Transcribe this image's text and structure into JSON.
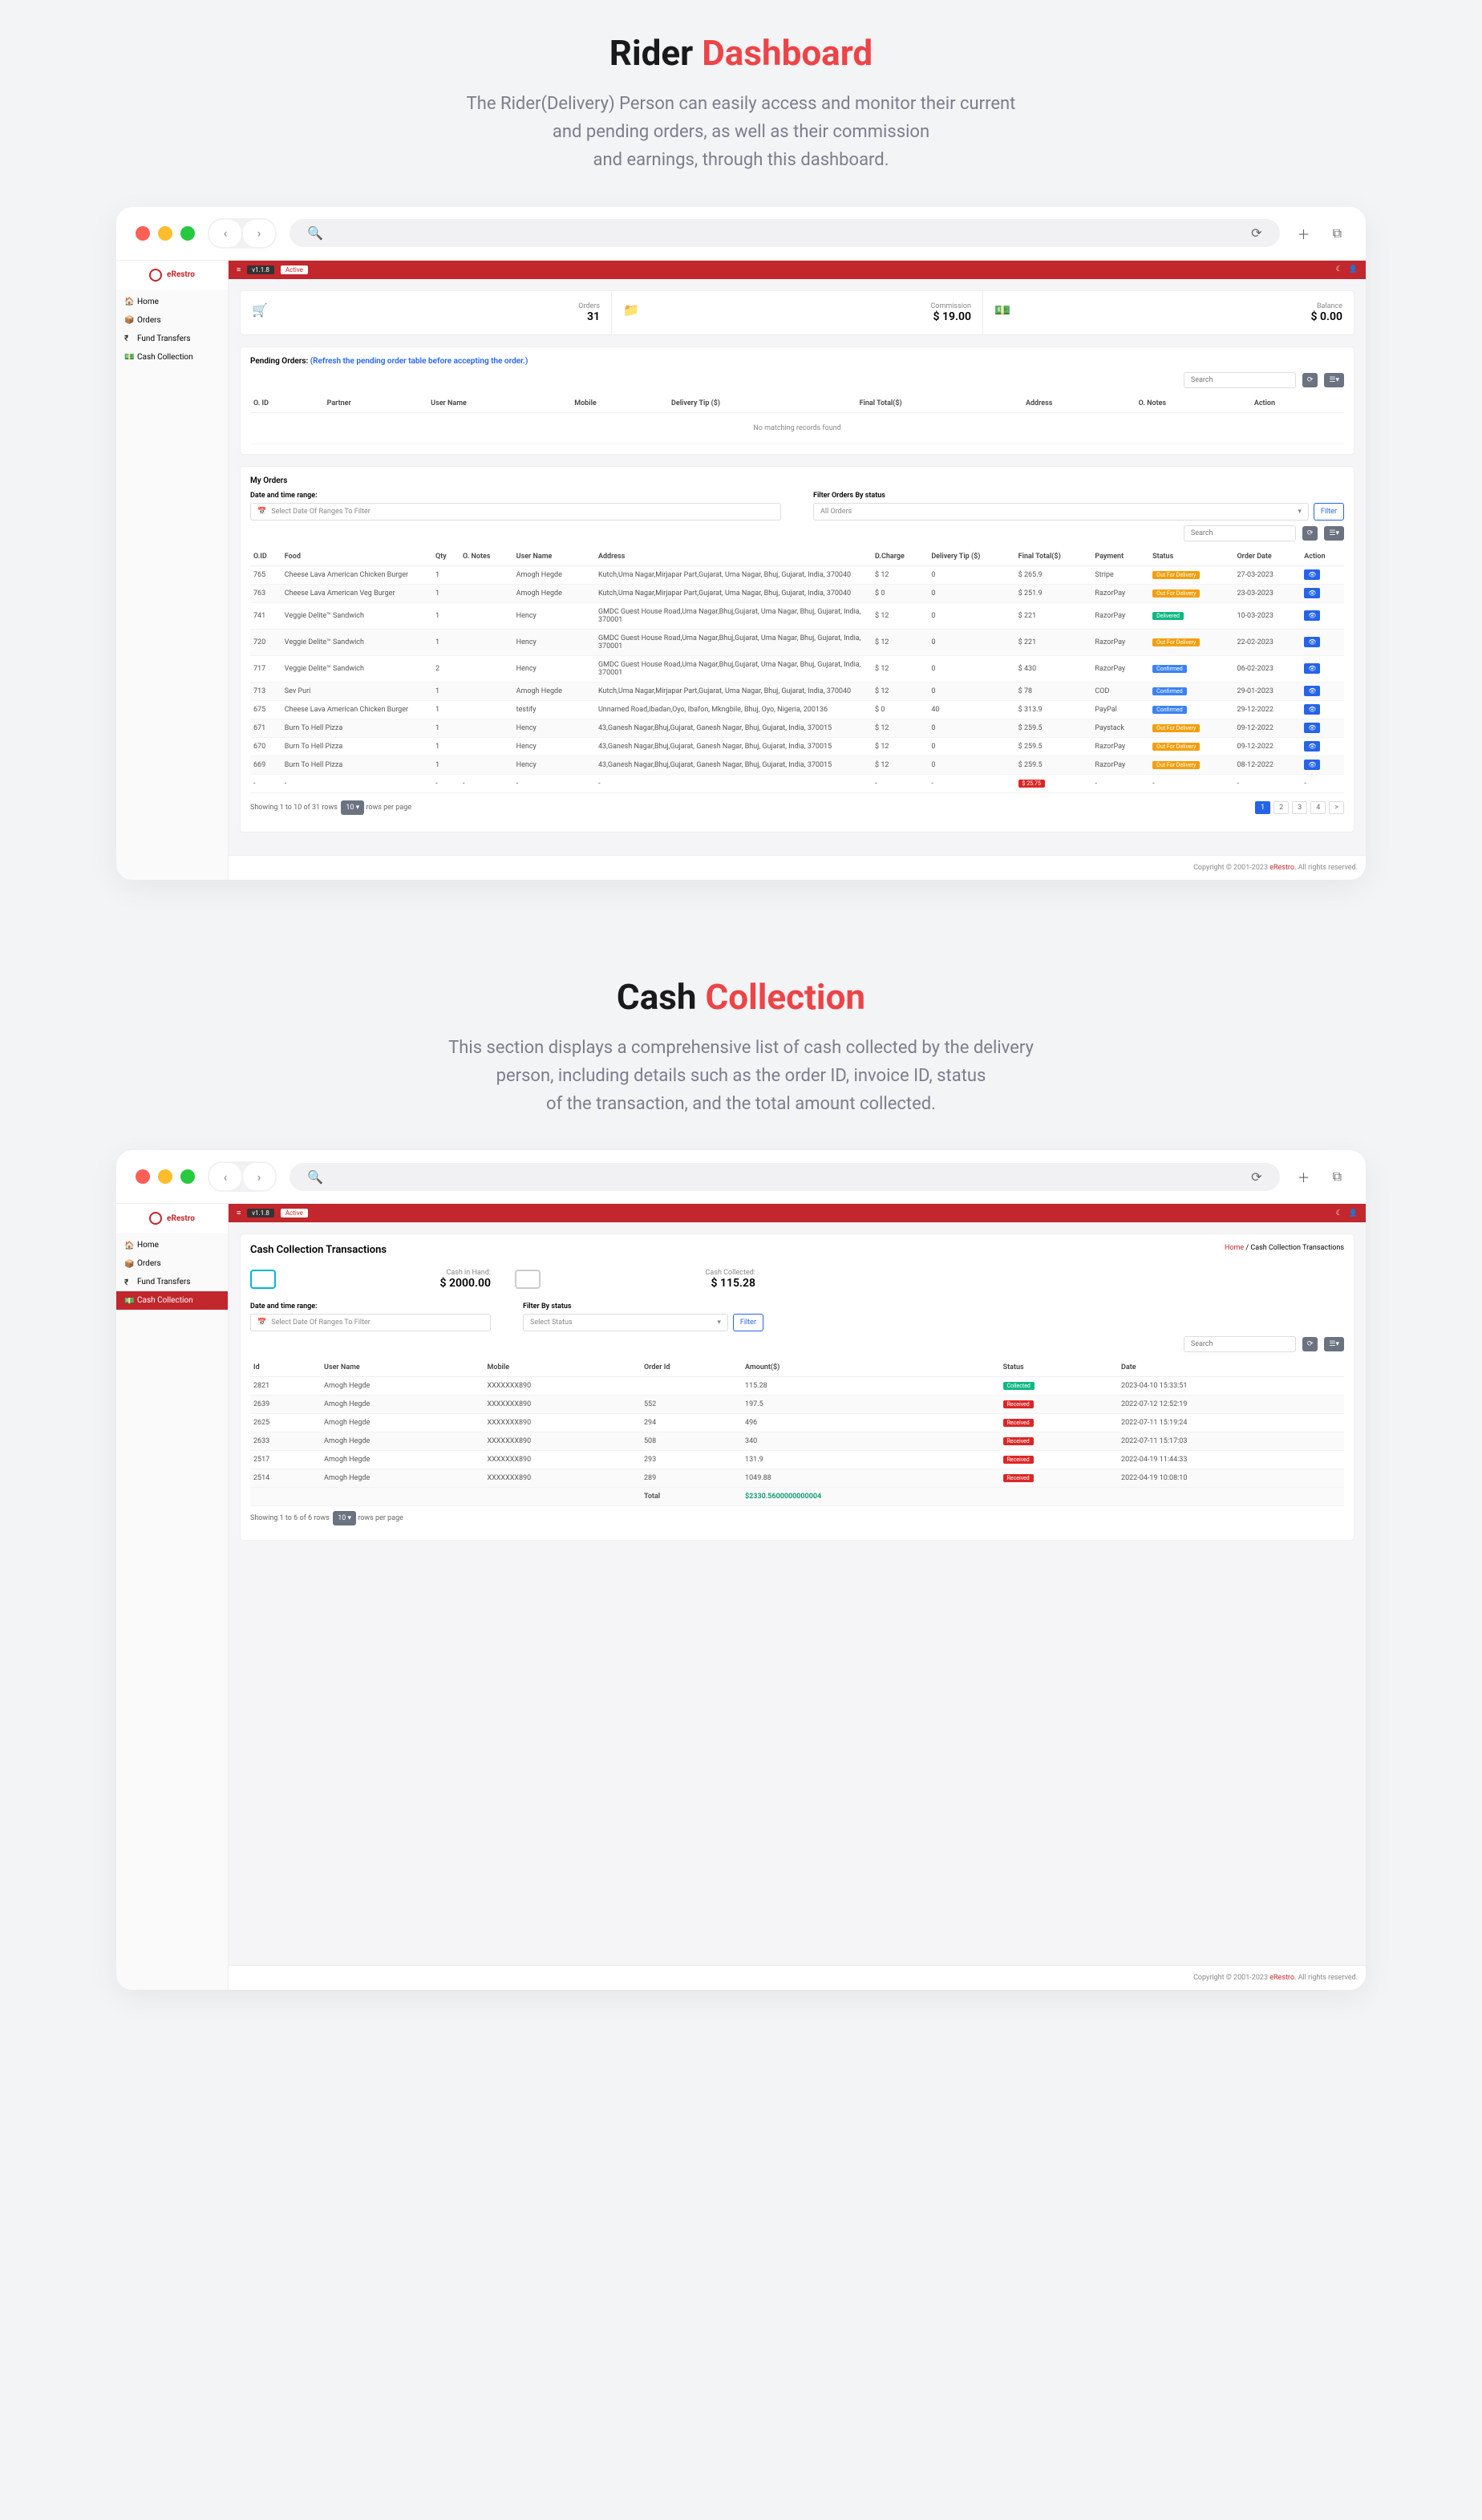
{
  "hero1": {
    "title1": "Rider",
    "title2": "Dashboard",
    "desc": "The Rider(Delivery) Person can easily access and monitor their current\nand pending orders, as well as their commission\nand earnings, through this dashboard."
  },
  "hero2": {
    "title1": "Cash",
    "title2": "Collection",
    "desc": "This section displays a comprehensive list of cash collected by the delivery\nperson, including details such as the order ID, invoice ID, status\nof the transaction, and the total amount collected."
  },
  "logo": "eRestro",
  "topbarVersion": "v1.1.8",
  "topbarStatus": "Active",
  "sidebar": [
    {
      "icon": "🏠",
      "label": "Home",
      "active": false
    },
    {
      "icon": "📦",
      "label": "Orders",
      "active": false
    },
    {
      "icon": "₹",
      "label": "Fund Transfers",
      "active": false
    },
    {
      "icon": "💵",
      "label": "Cash Collection",
      "active": false
    }
  ],
  "stats": [
    {
      "icon": "🛒",
      "color": "#f59e0b",
      "label": "Orders",
      "value": "31"
    },
    {
      "icon": "📁",
      "color": "#2563eb",
      "label": "Commission",
      "value": "$ 19.00"
    },
    {
      "icon": "💵",
      "color": "#10b981",
      "label": "Balance",
      "value": "$ 0.00"
    }
  ],
  "pending": {
    "title": "Pending Orders:",
    "link": "(Refresh the pending order table before accepting the order.)",
    "search": "Search",
    "headers": [
      "O. ID",
      "Partner",
      "User Name",
      "Mobile",
      "Delivery Tip ($)",
      "Final Total($)",
      "Address",
      "O. Notes",
      "Action"
    ],
    "empty": "No matching records found"
  },
  "myOrders": {
    "title": "My Orders",
    "filterDateLabel": "Date and time range:",
    "filterDatePh": "Select Date Of Ranges To Filter",
    "filterStatusLabel": "Filter Orders By status",
    "filterStatusPh": "All Orders",
    "filterBtn": "Filter",
    "search": "Search",
    "headers": [
      "O.ID",
      "Food",
      "Qty",
      "O. Notes",
      "User Name",
      "Address",
      "D.Charge",
      "Delivery Tip ($)",
      "Final Total($)",
      "Payment",
      "Status",
      "Order Date",
      "Action"
    ],
    "rows": [
      {
        "id": "765",
        "food": "Cheese Lava American Chicken Burger",
        "qty": "1",
        "notes": "",
        "user": "Amogh Hegde",
        "addr": "Kutch,Uma Nagar,Mirjapar Part,Gujarat, Uma Nagar, Bhuj, Gujarat, India, 370040",
        "dc": "$ 12",
        "tip": "0",
        "total": "$ 265.9",
        "pay": "Stripe",
        "status": "Out For Delivery",
        "sc": "s-out",
        "date": "27-03-2023"
      },
      {
        "id": "763",
        "food": "Cheese Lava American Veg Burger",
        "qty": "1",
        "notes": "",
        "user": "Amogh Hegde",
        "addr": "Kutch,Uma Nagar,Mirjapar Part,Gujarat, Uma Nagar, Bhuj, Gujarat, India, 370040",
        "dc": "$ 0",
        "tip": "0",
        "total": "$ 251.9",
        "pay": "RazorPay",
        "status": "Out For Delivery",
        "sc": "s-out",
        "date": "23-03-2023"
      },
      {
        "id": "741",
        "food": "Veggie Delite™ Sandwich",
        "qty": "1",
        "notes": "",
        "user": "Hency",
        "addr": "GMDC Guest House Road,Uma Nagar,Bhuj,Gujarat, Uma Nagar, Bhuj, Gujarat, India, 370001",
        "dc": "$ 12",
        "tip": "0",
        "total": "$ 221",
        "pay": "RazorPay",
        "status": "Delivered",
        "sc": "s-del",
        "date": "10-03-2023"
      },
      {
        "id": "720",
        "food": "Veggie Delite™ Sandwich",
        "qty": "1",
        "notes": "",
        "user": "Hency",
        "addr": "GMDC Guest House Road,Uma Nagar,Bhuj,Gujarat, Uma Nagar, Bhuj, Gujarat, India, 370001",
        "dc": "$ 12",
        "tip": "0",
        "total": "$ 221",
        "pay": "RazorPay",
        "status": "Out For Delivery",
        "sc": "s-out",
        "date": "22-02-2023"
      },
      {
        "id": "717",
        "food": "Veggie Delite™ Sandwich",
        "qty": "2",
        "notes": "",
        "user": "Hency",
        "addr": "GMDC Guest House Road,Uma Nagar,Bhuj,Gujarat, Uma Nagar, Bhuj, Gujarat, India, 370001",
        "dc": "$ 12",
        "tip": "0",
        "total": "$ 430",
        "pay": "RazorPay",
        "status": "Confirmed",
        "sc": "s-conf",
        "date": "06-02-2023"
      },
      {
        "id": "713",
        "food": "Sev Puri",
        "qty": "1",
        "notes": "",
        "user": "Amogh Hegde",
        "addr": "Kutch,Uma Nagar,Mirjapar Part,Gujarat, Uma Nagar, Bhuj, Gujarat, India, 370040",
        "dc": "$ 12",
        "tip": "0",
        "total": "$ 78",
        "pay": "COD",
        "status": "Confirmed",
        "sc": "s-conf",
        "date": "29-01-2023"
      },
      {
        "id": "675",
        "food": "Cheese Lava American Chicken Burger",
        "qty": "1",
        "notes": "",
        "user": "testify",
        "addr": "Unnamed Road,Ibadan,Oyo, Ibafon, Mkngbile, Bhuj, Oyo, Nigeria, 200136",
        "dc": "$ 0",
        "tip": "40",
        "total": "$ 313.9",
        "pay": "PayPal",
        "status": "Confirmed",
        "sc": "s-conf",
        "date": "29-12-2022"
      },
      {
        "id": "671",
        "food": "Burn To Hell Pizza",
        "qty": "1",
        "notes": "",
        "user": "Hency",
        "addr": "43,Ganesh Nagar,Bhuj,Gujarat, Ganesh Nagar, Bhuj, Gujarat, India, 370015",
        "dc": "$ 12",
        "tip": "0",
        "total": "$ 259.5",
        "pay": "Paystack",
        "status": "Out For Delivery",
        "sc": "s-out",
        "date": "09-12-2022"
      },
      {
        "id": "670",
        "food": "Burn To Hell Pizza",
        "qty": "1",
        "notes": "",
        "user": "Hency",
        "addr": "43,Ganesh Nagar,Bhuj,Gujarat, Ganesh Nagar, Bhuj, Gujarat, India, 370015",
        "dc": "$ 12",
        "tip": "0",
        "total": "$ 259.5",
        "pay": "RazorPay",
        "status": "Out For Delivery",
        "sc": "s-out",
        "date": "09-12-2022"
      },
      {
        "id": "669",
        "food": "Burn To Hell Pizza",
        "qty": "1",
        "notes": "",
        "user": "Hency",
        "addr": "43,Ganesh Nagar,Bhuj,Gujarat, Ganesh Nagar, Bhuj, Gujarat, India, 370015",
        "dc": "$ 12",
        "tip": "0",
        "total": "$ 259.5",
        "pay": "RazorPay",
        "status": "Out For Delivery",
        "sc": "s-out",
        "date": "08-12-2022"
      }
    ],
    "extraRow": {
      "dash": "-",
      "price": "$ 25.75"
    },
    "pagerText": "Showing 1 to 10 of 31 rows",
    "perPage": "10",
    "perPageSuffix": "rows per page",
    "pages": [
      "1",
      "2",
      "3",
      "4",
      ">"
    ]
  },
  "footer": {
    "copy": "Copyright © 2001-2023",
    "brand": "eRestro.",
    "rights": "All rights reserved."
  },
  "cash": {
    "title": "Cash Collection Transactions",
    "bcHome": "Home",
    "bcSep": "/",
    "bcCurrent": "Cash Collection Transactions",
    "stat1Label": "Cash in Hand:",
    "stat1Val": "$ 2000.00",
    "stat2Label": "Cash Collected:",
    "stat2Val": "$ 115.28",
    "filterDateLabel": "Date and time range:",
    "filterDatePh": "Select Date Of Ranges To Filter",
    "filterStatusLabel": "Filter By status",
    "filterStatusPh": "Select Status",
    "filterBtn": "Filter",
    "search": "Search",
    "headers": [
      "Id",
      "User Name",
      "Mobile",
      "Order Id",
      "Amount($)",
      "Status",
      "Date"
    ],
    "rows": [
      {
        "id": "2821",
        "user": "Amogh Hegde",
        "mobile": "XXXXXXX890",
        "order": "",
        "amt": "115.28",
        "status": "Collected",
        "sc": "s-col",
        "date": "2023-04-10 15:33:51"
      },
      {
        "id": "2639",
        "user": "Amogh Hegde",
        "mobile": "XXXXXXX890",
        "order": "552",
        "amt": "197.5",
        "status": "Received",
        "sc": "s-rec",
        "date": "2022-07-12 12:52:19"
      },
      {
        "id": "2625",
        "user": "Amogh Hegde",
        "mobile": "XXXXXXX890",
        "order": "294",
        "amt": "496",
        "status": "Received",
        "sc": "s-rec",
        "date": "2022-07-11 15:19:24"
      },
      {
        "id": "2633",
        "user": "Amogh Hegde",
        "mobile": "XXXXXXX890",
        "order": "508",
        "amt": "340",
        "status": "Received",
        "sc": "s-rec",
        "date": "2022-07-11 15:17:03"
      },
      {
        "id": "2517",
        "user": "Amogh Hegde",
        "mobile": "XXXXXXX890",
        "order": "293",
        "amt": "131.9",
        "status": "Received",
        "sc": "s-rec",
        "date": "2022-04-19 11:44:33"
      },
      {
        "id": "2514",
        "user": "Amogh Hegde",
        "mobile": "XXXXXXX890",
        "order": "289",
        "amt": "1049.88",
        "status": "Received",
        "sc": "s-rec",
        "date": "2022-04-19 10:08:10"
      }
    ],
    "totalLabel": "Total",
    "totalVal": "$2330.5600000000004",
    "pagerText": "Showing 1 to 6 of 6 rows",
    "perPage": "10",
    "perPageSuffix": "rows per page"
  },
  "sidebar2": [
    {
      "icon": "🏠",
      "label": "Home",
      "active": false
    },
    {
      "icon": "📦",
      "label": "Orders",
      "active": false
    },
    {
      "icon": "₹",
      "label": "Fund Transfers",
      "active": false
    },
    {
      "icon": "💵",
      "label": "Cash Collection",
      "active": true
    }
  ]
}
